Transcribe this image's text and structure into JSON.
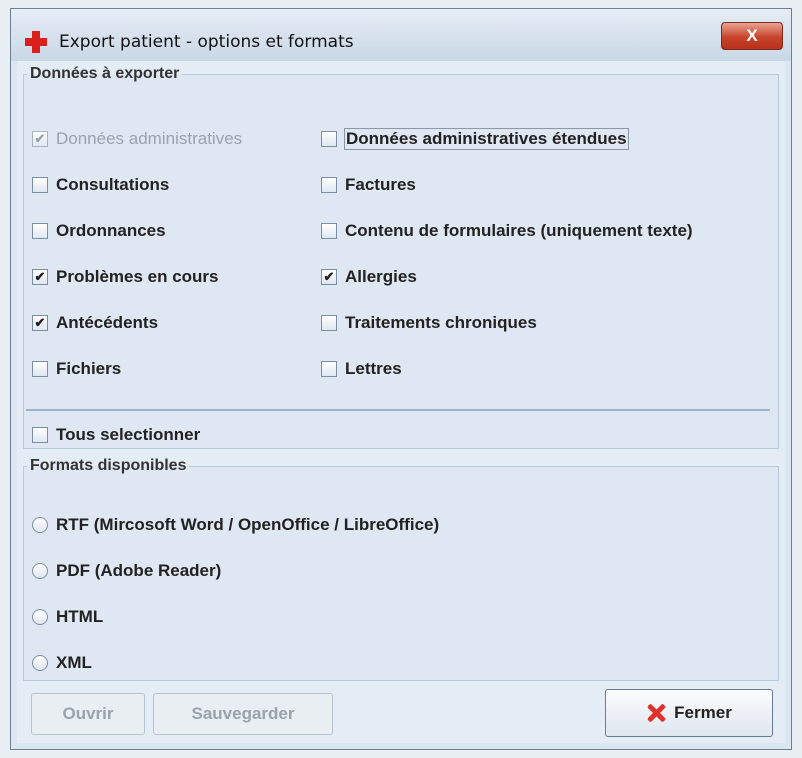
{
  "window": {
    "title": "Export patient - options et formats",
    "close_glyph": "X"
  },
  "data_group": {
    "legend": "Données à exporter",
    "left_items": [
      {
        "label": "Données administratives",
        "checked": true,
        "disabled": true
      },
      {
        "label": "Consultations",
        "checked": false
      },
      {
        "label": "Ordonnances",
        "checked": false
      },
      {
        "label": "Problèmes en cours",
        "checked": true
      },
      {
        "label": "Antécédents",
        "checked": true
      },
      {
        "label": "Fichiers",
        "checked": false
      }
    ],
    "right_items": [
      {
        "label": "Données administratives étendues",
        "checked": false,
        "focused": true
      },
      {
        "label": "Factures",
        "checked": false
      },
      {
        "label": "Contenu de formulaires (uniquement texte)",
        "checked": false
      },
      {
        "label": "Allergies",
        "checked": true
      },
      {
        "label": "Traitements chroniques",
        "checked": false
      },
      {
        "label": "Lettres",
        "checked": false
      }
    ],
    "select_all": {
      "label": "Tous selectionner",
      "checked": false
    }
  },
  "formats_group": {
    "legend": "Formats disponibles",
    "options": [
      {
        "label": "RTF (Mircosoft Word / OpenOffice / LibreOffice)",
        "selected": false
      },
      {
        "label": "PDF (Adobe Reader)",
        "selected": false
      },
      {
        "label": "HTML",
        "selected": false
      },
      {
        "label": "XML",
        "selected": false
      }
    ]
  },
  "buttons": {
    "open": "Ouvrir",
    "save": "Sauvegarder",
    "close": "Fermer"
  },
  "colors": {
    "accent_red": "#d9201d",
    "title_close_red": "#c8432b",
    "panel_bg": "#dfe8f2"
  },
  "check_glyph": "✔"
}
